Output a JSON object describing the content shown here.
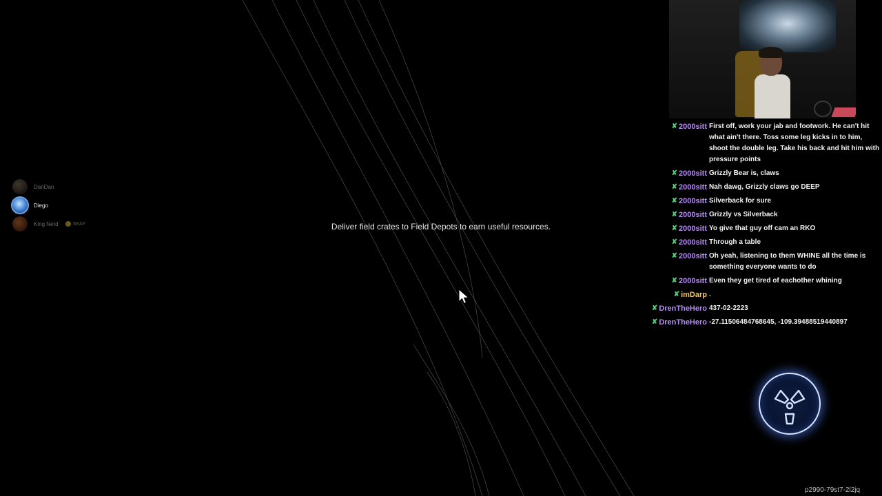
{
  "party": {
    "members": [
      {
        "name": "DanDan",
        "state": "dim"
      },
      {
        "name": "Diego",
        "state": "active"
      },
      {
        "name": "King Nerd",
        "state": "dim",
        "badge": "SEAF"
      }
    ]
  },
  "objective": {
    "text": "Deliver field crates to Field Depots to earn useful resources."
  },
  "chat": {
    "icon_color": "#4bd17a",
    "messages": [
      {
        "user": "2000sitt",
        "color": "#b48df0",
        "text": "First off, work your jab and footwork. He can't hit what ain't there. Toss some leg kicks in to him, shoot the double leg. Take his back and hit him with pressure points"
      },
      {
        "user": "2000sitt",
        "color": "#b48df0",
        "text": "Grizzly Bear is, claws"
      },
      {
        "user": "2000sitt",
        "color": "#b48df0",
        "text": "Nah dawg, Grizzly claws go DEEP"
      },
      {
        "user": "2000sitt",
        "color": "#b48df0",
        "text": "Silverback for sure"
      },
      {
        "user": "2000sitt",
        "color": "#b48df0",
        "text": "Grizzly vs Silverback"
      },
      {
        "user": "2000sitt",
        "color": "#b48df0",
        "text": "Yo give that guy off cam an RKO"
      },
      {
        "user": "2000sitt",
        "color": "#b48df0",
        "text": "Through a table"
      },
      {
        "user": "2000sitt",
        "color": "#b48df0",
        "text": "Oh yeah, listening to them WHINE all the time is something everyone wants to do"
      },
      {
        "user": "2000sitt",
        "color": "#b48df0",
        "text": "Even they get tired of eachother whining"
      },
      {
        "user": "imDarp",
        "color": "#f0c76a",
        "text": "."
      },
      {
        "user": "DrenTheHero",
        "color": "#b48df0",
        "text": "437-02-2223"
      },
      {
        "user": "DrenTheHero",
        "color": "#b48df0",
        "text": "-27.11506484768645, -109.39488519440897"
      }
    ]
  },
  "ability": {
    "icon": "radiation-triskelion-icon",
    "glow_color": "#5082ff"
  },
  "footer": {
    "session_id": "p2990-79st7-2l2jq"
  }
}
